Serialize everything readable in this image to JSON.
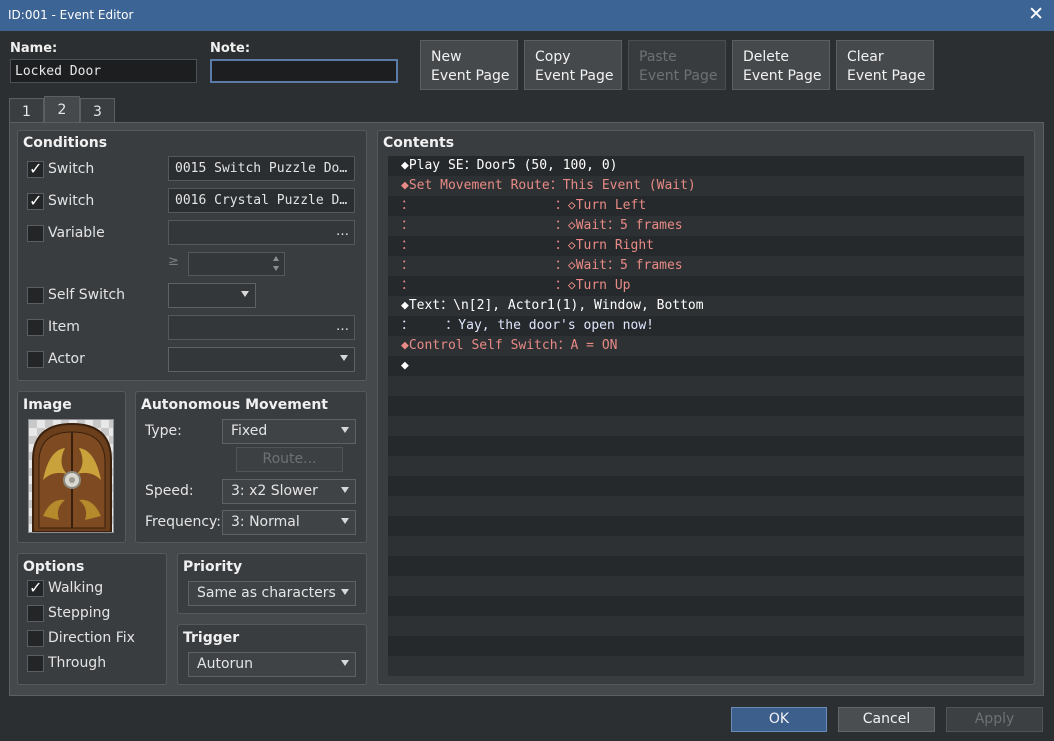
{
  "window": {
    "title": "ID:001 - Event Editor",
    "close_glyph": "✕"
  },
  "name": {
    "label": "Name:",
    "value": "Locked Door"
  },
  "note": {
    "label": "Note:",
    "value": ""
  },
  "page_buttons": [
    {
      "line1": "New",
      "line2": "Event Page",
      "enabled": true
    },
    {
      "line1": "Copy",
      "line2": "Event Page",
      "enabled": true
    },
    {
      "line1": "Paste",
      "line2": "Event Page",
      "enabled": false
    },
    {
      "line1": "Delete",
      "line2": "Event Page",
      "enabled": true
    },
    {
      "line1": "Clear",
      "line2": "Event Page",
      "enabled": true
    }
  ],
  "tabs": [
    "1",
    "2",
    "3"
  ],
  "active_tab": "2",
  "conditions": {
    "title": "Conditions",
    "switch1": {
      "label": "Switch",
      "checked": true,
      "value": "0015 Switch Puzzle Do…",
      "dots": "…"
    },
    "switch2": {
      "label": "Switch",
      "checked": true,
      "value": "0016 Crystal Puzzle D…",
      "dots": "…"
    },
    "variable": {
      "label": "Variable",
      "checked": false,
      "value": "",
      "dots": "…",
      "ge": "≥"
    },
    "self_switch": {
      "label": "Self Switch",
      "checked": false
    },
    "item": {
      "label": "Item",
      "checked": false,
      "dots": "…"
    },
    "actor": {
      "label": "Actor",
      "checked": false
    }
  },
  "image": {
    "title": "Image"
  },
  "autonomous": {
    "title": "Autonomous Movement",
    "type_label": "Type:",
    "type_value": "Fixed",
    "route_label": "Route...",
    "speed_label": "Speed:",
    "speed_value": "3: x2 Slower",
    "freq_label": "Frequency:",
    "freq_value": "3: Normal"
  },
  "contents": {
    "title": "Contents",
    "lines": [
      {
        "color": "w",
        "text": "◆Play SE：Door5 (50, 100, 0)"
      },
      {
        "color": "r",
        "text": "◆Set Movement Route：This Event (Wait)"
      },
      {
        "color": "r",
        "text": "：                  ：◇Turn Left"
      },
      {
        "color": "r",
        "text": "：                  ：◇Wait：5 frames"
      },
      {
        "color": "r",
        "text": "：                  ：◇Turn Right"
      },
      {
        "color": "r",
        "text": "：                  ：◇Wait：5 frames"
      },
      {
        "color": "r",
        "text": "：                  ：◇Turn Up"
      },
      {
        "color": "w",
        "text": "◆Text：\\n[2], Actor1(1), Window, Bottom"
      },
      {
        "color": "b",
        "text": "：    ：Yay, the door's open now!"
      },
      {
        "color": "r",
        "text": "◆Control Self Switch：A = ON"
      },
      {
        "color": "w",
        "text": "◆"
      }
    ],
    "empty_rows": 15
  },
  "options": {
    "title": "Options",
    "items": [
      {
        "label": "Walking",
        "checked": true
      },
      {
        "label": "Stepping",
        "checked": false
      },
      {
        "label": "Direction Fix",
        "checked": false
      },
      {
        "label": "Through",
        "checked": false
      }
    ]
  },
  "priority": {
    "title": "Priority",
    "value": "Same as characters"
  },
  "trigger": {
    "title": "Trigger",
    "value": "Autorun"
  },
  "footer": {
    "ok": "OK",
    "cancel": "Cancel",
    "apply": "Apply"
  }
}
